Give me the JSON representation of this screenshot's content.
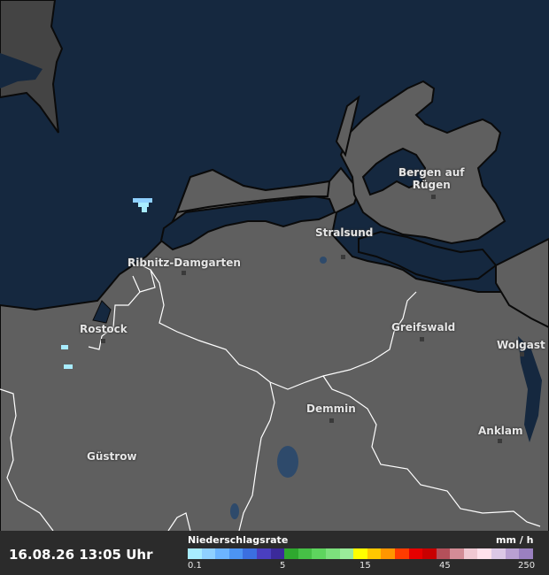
{
  "map": {
    "cities": [
      {
        "id": "bergen",
        "name": "Bergen auf\nRügen"
      },
      {
        "id": "stralsund",
        "name": "Stralsund"
      },
      {
        "id": "ribnitz",
        "name": "Ribnitz-Damgarten"
      },
      {
        "id": "rostock",
        "name": "Rostock"
      },
      {
        "id": "greifswald",
        "name": "Greifswald"
      },
      {
        "id": "wolgast",
        "name": "Wolgast"
      },
      {
        "id": "demmin",
        "name": "Demmin"
      },
      {
        "id": "anklam",
        "name": "Anklam"
      },
      {
        "id": "guestrow",
        "name": "Güstrow"
      }
    ],
    "colors": {
      "sea": "#15283f",
      "land": "#5f5f5f",
      "land_dark": "#444444",
      "border": "#ffffff",
      "coast": "#0a0a0a"
    }
  },
  "footer": {
    "timestamp": "16.08.26 13:05 Uhr",
    "legend_title": "Niederschlagsrate",
    "legend_unit": "mm / h",
    "ticks": [
      "0.1",
      "5",
      "15",
      "45",
      "250"
    ],
    "scale_colors": [
      "#a8ecff",
      "#8fd0ff",
      "#6cb4ff",
      "#4c94f2",
      "#3b6fe0",
      "#4a3fc0",
      "#3b2a9a",
      "#2ea82e",
      "#46c046",
      "#5ed45e",
      "#7ce07c",
      "#9aeb9a",
      "#ffff00",
      "#ffc800",
      "#ff9600",
      "#ff3c00",
      "#e60000",
      "#c80000",
      "#b4505a",
      "#d28c96",
      "#f0c8d2",
      "#ffe1eb",
      "#dcc8e6",
      "#b9a0d2",
      "#9a80c0"
    ]
  }
}
